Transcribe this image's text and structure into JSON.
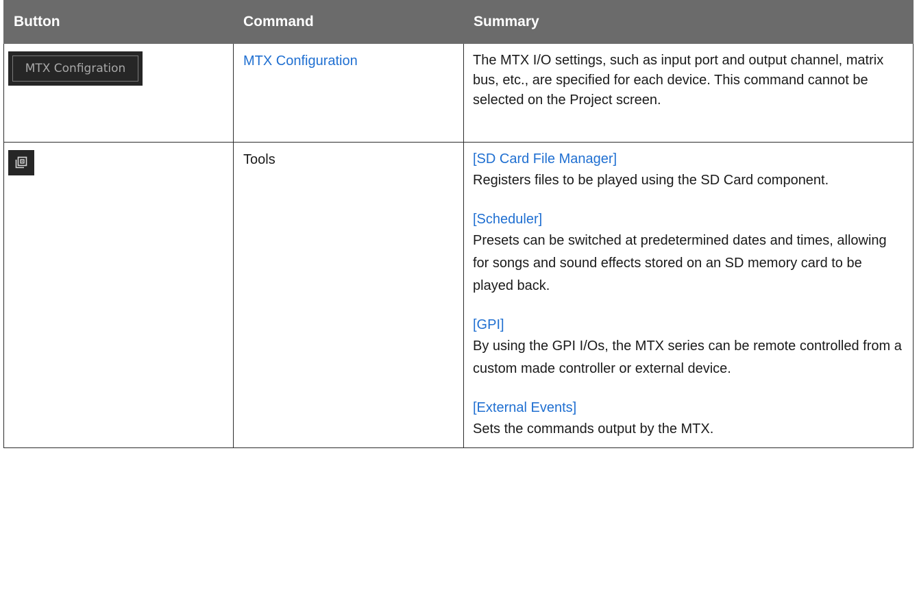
{
  "table": {
    "headers": [
      "Button",
      "Command",
      "Summary"
    ],
    "rows": [
      {
        "button_label": "MTX Configration",
        "command": "MTX Configuration",
        "summary": "The MTX I/O settings, such as input port and output channel, matrix bus, etc., are specified for each device. This command cannot be selected on the Project screen."
      },
      {
        "button_icon": "tools-icon",
        "command": "Tools",
        "sections": [
          {
            "title": "[SD Card File Manager]",
            "text": "Registers files to be played using the SD Card component."
          },
          {
            "title": "[Scheduler]",
            "text": "Presets can be switched at predetermined dates and times, allowing for songs and sound effects stored on an SD memory card to be played back."
          },
          {
            "title": "[GPI]",
            "text": "By using the GPI I/Os, the MTX series can be remote controlled from a custom made controller or external device."
          },
          {
            "title": "[External Events]",
            "text": "Sets the commands output by the MTX."
          }
        ]
      }
    ]
  },
  "colors": {
    "header_bg": "#6b6b6b",
    "link": "#1f6fd1",
    "button_bg": "#262626"
  }
}
